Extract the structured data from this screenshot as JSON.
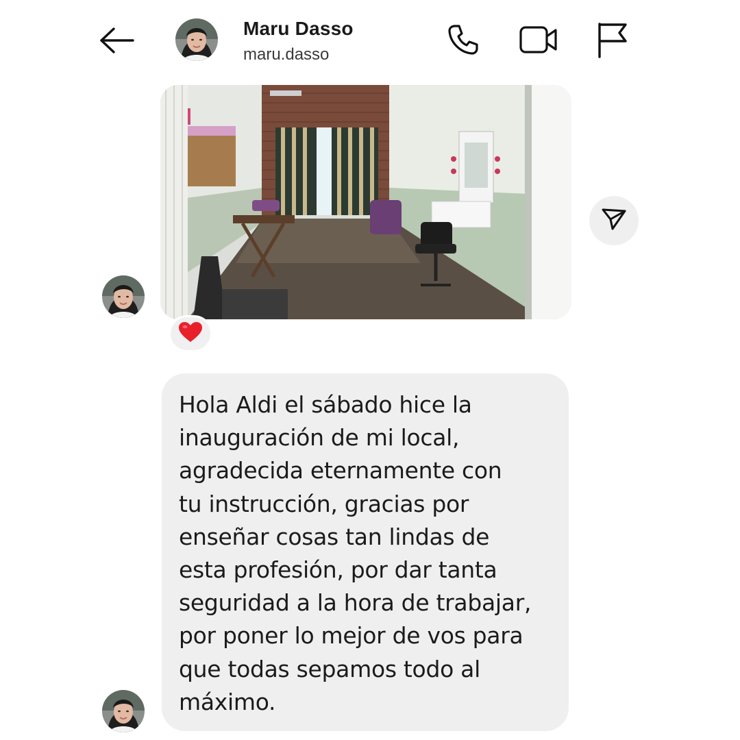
{
  "header": {
    "back_icon": "arrow-left-icon",
    "contact_name": "Maru Dasso",
    "contact_handle": "maru.dasso",
    "actions": {
      "call_icon": "phone-icon",
      "video_icon": "video-camera-icon",
      "report_icon": "flag-icon"
    }
  },
  "conversation": {
    "photo_message": {
      "reaction": "❤️",
      "reaction_icon": "heart-icon",
      "share_icon": "paper-plane-icon"
    },
    "text_message": {
      "lines": [
        "Hola Aldi el sábado hice la",
        "inauguración de mi local,",
        "agradecida eternamente con",
        "tu instrucción, gracias por",
        "enseñar cosas tan lindas de",
        "esta profesión, por dar tanta",
        "seguridad a la hora de trabajar,",
        "por poner lo mejor de vos para",
        "que todas sepamos todo al",
        "máximo."
      ]
    }
  },
  "colors": {
    "bubble_background": "#efefef",
    "text": "#1b1b1b",
    "heart": "#e8202a"
  }
}
